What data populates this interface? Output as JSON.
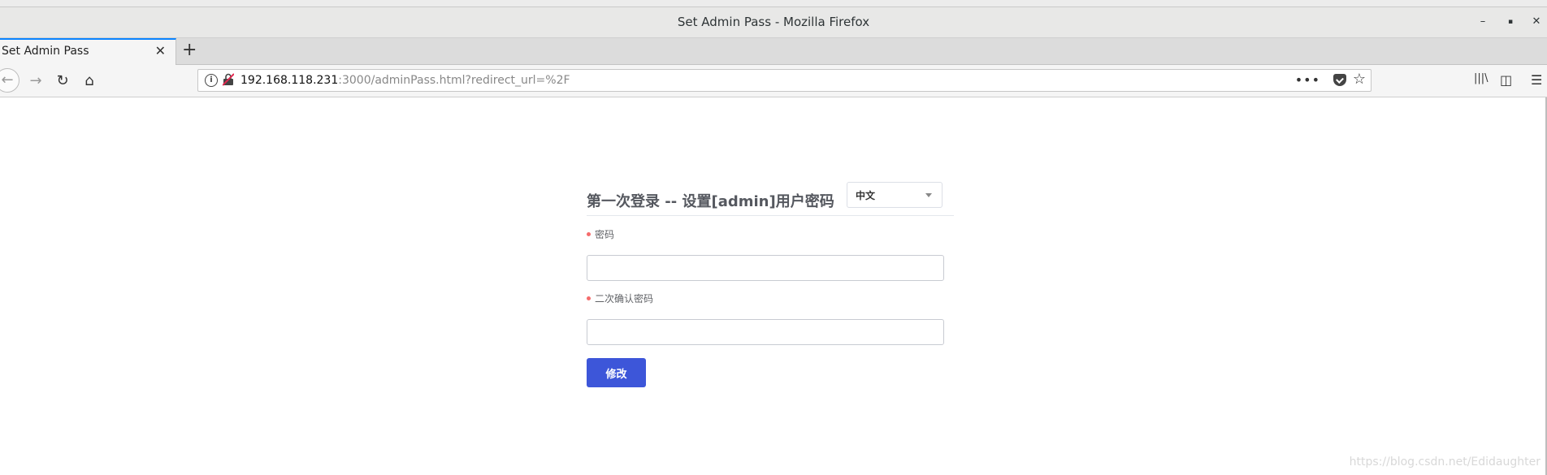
{
  "window": {
    "title": "Set Admin Pass - Mozilla Firefox",
    "minimize": "–",
    "maximize": "▪",
    "close": "✕"
  },
  "tab": {
    "title": "Set Admin Pass",
    "close": "✕",
    "new_tab": "+"
  },
  "nav": {
    "back": "←",
    "forward": "→",
    "reload": "↻",
    "home": "⌂",
    "url_host": "192.168.118.231",
    "url_rest": ":3000/adminPass.html?redirect_url=%2F",
    "page_actions": "•••",
    "star": "☆",
    "library": "|||\\",
    "sidebar": "◫",
    "menu": "☰"
  },
  "form": {
    "title": "第一次登录 -- 设置[admin]用户密码",
    "language_selected": "中文",
    "password_label": "密码",
    "password_value": "",
    "confirm_label": "二次确认密码",
    "confirm_value": "",
    "submit_label": "修改"
  },
  "watermark": "https://blog.csdn.net/Edidaughter"
}
